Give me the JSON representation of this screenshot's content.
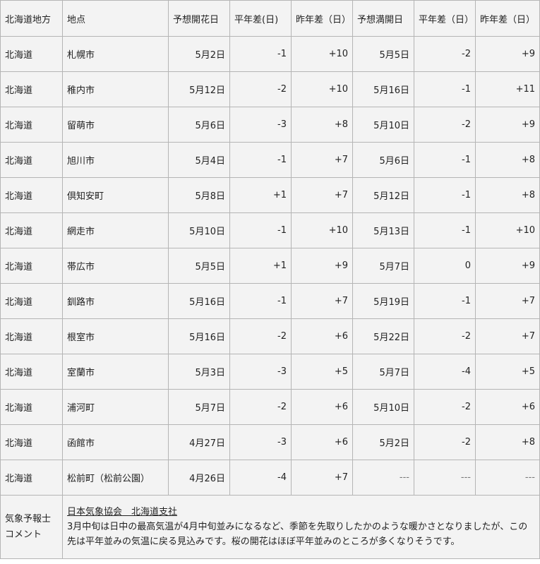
{
  "table": {
    "headers": [
      "北海道地方",
      "地点",
      "予想開花日",
      "平年差(日)",
      "昨年差（日）",
      "予想満開日",
      "平年差（日）",
      "昨年差（日）"
    ],
    "rows": [
      [
        "北海道",
        "札幌市",
        "5月2日",
        "-1",
        "+10",
        "5月5日",
        "-2",
        "+9"
      ],
      [
        "北海道",
        "稚内市",
        "5月12日",
        "-2",
        "+10",
        "5月16日",
        "-1",
        "+11"
      ],
      [
        "北海道",
        "留萌市",
        "5月6日",
        "-3",
        "+8",
        "5月10日",
        "-2",
        "+9"
      ],
      [
        "北海道",
        "旭川市",
        "5月4日",
        "-1",
        "+7",
        "5月6日",
        "-1",
        "+8"
      ],
      [
        "北海道",
        "倶知安町",
        "5月8日",
        "+1",
        "+7",
        "5月12日",
        "-1",
        "+8"
      ],
      [
        "北海道",
        "網走市",
        "5月10日",
        "-1",
        "+10",
        "5月13日",
        "-1",
        "+10"
      ],
      [
        "北海道",
        "帯広市",
        "5月5日",
        "+1",
        "+9",
        "5月7日",
        "0",
        "+9"
      ],
      [
        "北海道",
        "釧路市",
        "5月16日",
        "-1",
        "+7",
        "5月19日",
        "-1",
        "+7"
      ],
      [
        "北海道",
        "根室市",
        "5月16日",
        "-2",
        "+6",
        "5月22日",
        "-2",
        "+7"
      ],
      [
        "北海道",
        "室蘭市",
        "5月3日",
        "-3",
        "+5",
        "5月7日",
        "-4",
        "+5"
      ],
      [
        "北海道",
        "浦河町",
        "5月7日",
        "-2",
        "+6",
        "5月10日",
        "-2",
        "+6"
      ],
      [
        "北海道",
        "函館市",
        "4月27日",
        "-3",
        "+6",
        "5月2日",
        "-2",
        "+8"
      ],
      [
        "北海道",
        "松前町（松前公園）",
        "4月26日",
        "-4",
        "+7",
        "---",
        "---",
        "---"
      ]
    ]
  },
  "comment": {
    "label_line1": "気象予報士",
    "label_line2": "コメント",
    "source": "日本気象協会　北海道支社",
    "text": "3月中旬は日中の最高気温が4月中旬並みになるなど、季節を先取りしたかのような暖かさとなりましたが、この先は平年並みの気温に戻る見込みです。桜の開花はほぼ平年並みのところが多くなりそうです。"
  }
}
